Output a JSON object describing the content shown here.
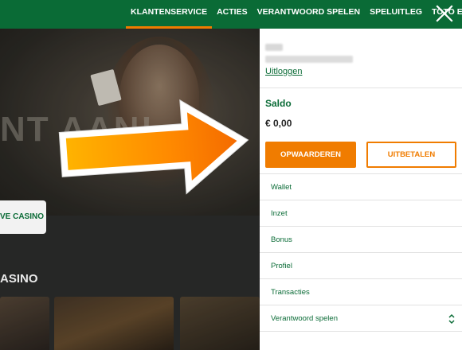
{
  "nav": {
    "items": [
      "KLANTENSERVICE",
      "ACTIES",
      "VERANTWOORD SPELEN",
      "SPELUITLEG",
      "TOTO EXTRA"
    ],
    "active_index": 0,
    "close_icon": "close-icon"
  },
  "background": {
    "hero_text": "NT AAN!",
    "live_button_label": "VE CASINO",
    "section_title": "ASINO"
  },
  "account": {
    "logout_label": "Uitloggen",
    "balance_label": "Saldo",
    "balance_value": "€ 0,00",
    "topup_label": "OPWAARDEREN",
    "payout_label": "UITBETALEN",
    "menu": [
      "Wallet",
      "Inzet",
      "Bonus",
      "Profiel",
      "Transacties",
      "Verantwoord spelen"
    ]
  },
  "colors": {
    "brand_green": "#0a6b36",
    "accent_orange": "#f07c00"
  }
}
